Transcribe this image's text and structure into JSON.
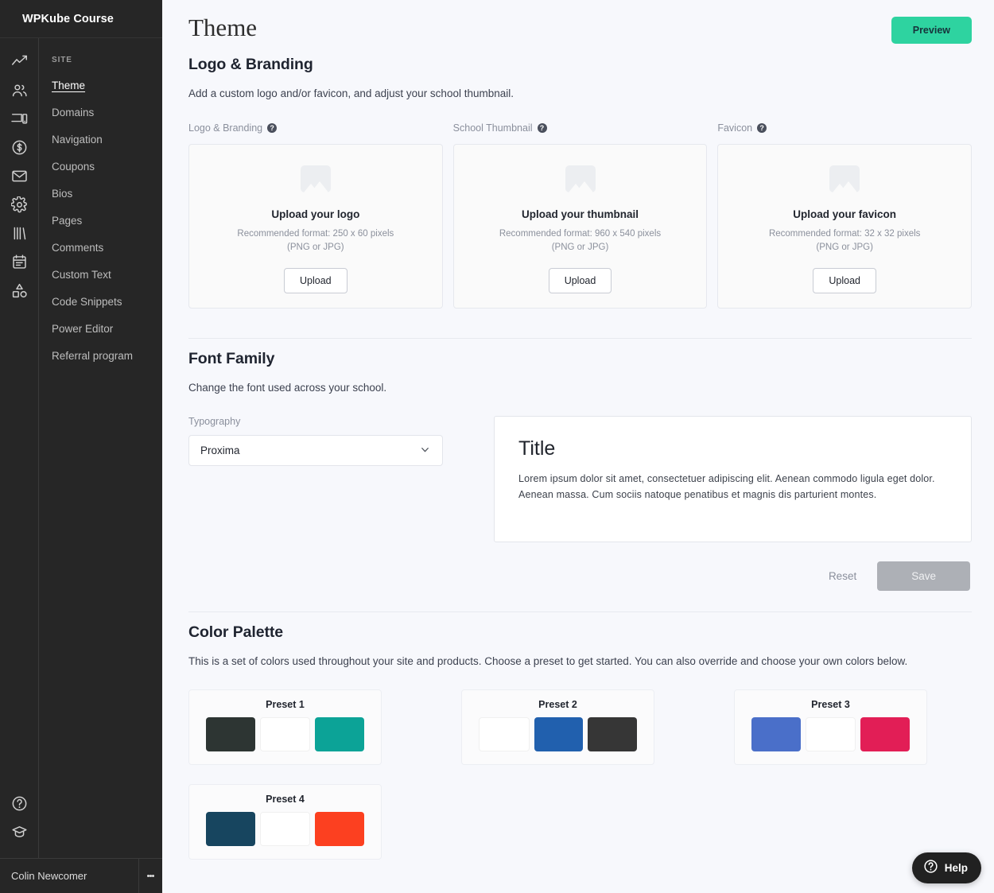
{
  "sidebar": {
    "brand": "WPKube Course",
    "rail_icons": [
      {
        "name": "analytics-icon"
      },
      {
        "name": "people-icon"
      },
      {
        "name": "devices-icon"
      },
      {
        "name": "dollar-circle-icon"
      },
      {
        "name": "envelope-icon"
      },
      {
        "name": "gear-icon"
      },
      {
        "name": "library-icon"
      },
      {
        "name": "calendar-icon"
      },
      {
        "name": "shapes-icon"
      }
    ],
    "rail_bottom_icons": [
      {
        "name": "help-circle-icon"
      },
      {
        "name": "graduation-cap-icon"
      }
    ],
    "section_label": "SITE",
    "items": [
      {
        "label": "Theme",
        "active": true
      },
      {
        "label": "Domains",
        "active": false
      },
      {
        "label": "Navigation",
        "active": false
      },
      {
        "label": "Coupons",
        "active": false
      },
      {
        "label": "Bios",
        "active": false
      },
      {
        "label": "Pages",
        "active": false
      },
      {
        "label": "Comments",
        "active": false
      },
      {
        "label": "Custom Text",
        "active": false
      },
      {
        "label": "Code Snippets",
        "active": false
      },
      {
        "label": "Power Editor",
        "active": false
      },
      {
        "label": "Referral program",
        "active": false
      }
    ],
    "footer_user": "Colin Newcomer"
  },
  "header": {
    "title": "Theme",
    "preview_label": "Preview",
    "preview_color": "#2ed3a0"
  },
  "logo_branding": {
    "heading": "Logo & Branding",
    "description": "Add a custom logo and/or favicon, and adjust your school thumbnail.",
    "cards": [
      {
        "label": "Logo & Branding",
        "title": "Upload your logo",
        "desc_line1": "Recommended format: 250 x 60 pixels",
        "desc_line2": "(PNG or JPG)",
        "button": "Upload"
      },
      {
        "label": "School Thumbnail",
        "title": "Upload your thumbnail",
        "desc_line1": "Recommended format: 960 x 540 pixels",
        "desc_line2": "(PNG or JPG)",
        "button": "Upload"
      },
      {
        "label": "Favicon",
        "title": "Upload your favicon",
        "desc_line1": "Recommended format: 32 x 32 pixels",
        "desc_line2": "(PNG or JPG)",
        "button": "Upload"
      }
    ]
  },
  "font_family": {
    "heading": "Font Family",
    "description": "Change the font used across your school.",
    "field_label": "Typography",
    "selected": "Proxima",
    "options": [
      "Proxima"
    ],
    "preview_title": "Title",
    "preview_body": "Lorem ipsum dolor sit amet, consectetuer adipiscing elit. Aenean commodo ligula eget dolor. Aenean massa. Cum sociis natoque penatibus et magnis dis parturient montes.",
    "reset_label": "Reset",
    "save_label": "Save"
  },
  "color_palette": {
    "heading": "Color Palette",
    "description": "This is a set of colors used throughout your site and products. Choose a preset to get started. You can also override and choose your own colors below.",
    "presets": [
      {
        "name": "Preset 1",
        "colors": [
          "#2d3533",
          "#ffffff",
          "#0ca397"
        ]
      },
      {
        "name": "Preset 2",
        "colors": [
          "#ffffff",
          "#2160ae",
          "#363636"
        ]
      },
      {
        "name": "Preset 3",
        "colors": [
          "#4a6fc9",
          "#ffffff",
          "#e21e56"
        ]
      },
      {
        "name": "Preset 4",
        "colors": [
          "#17455f",
          "#ffffff",
          "#fc4020"
        ]
      }
    ]
  },
  "help_widget": {
    "label": "Help"
  }
}
